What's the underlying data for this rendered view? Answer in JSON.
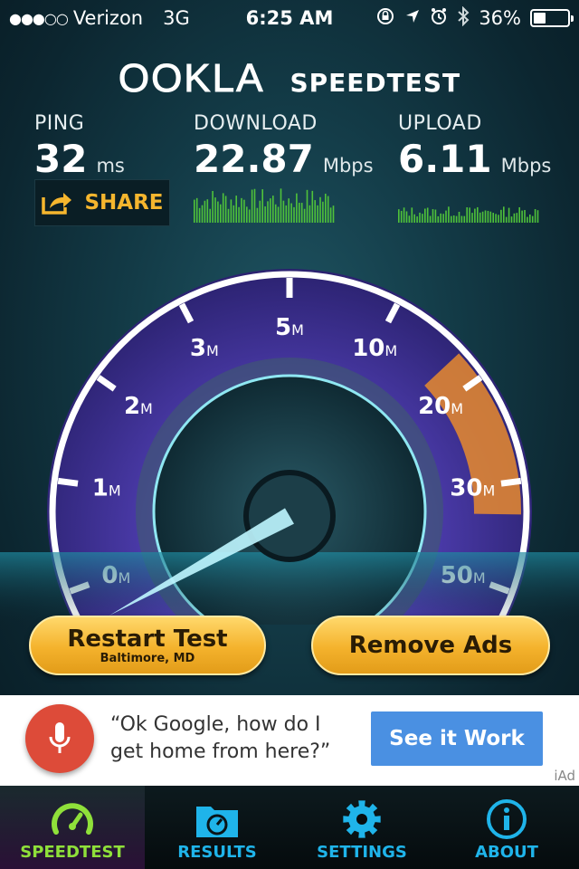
{
  "status_bar": {
    "signal": "●●●○○",
    "carrier": "Verizon",
    "network": "3G",
    "time": "6:25 AM",
    "battery_text": "36%",
    "battery_level": 0.36
  },
  "logo": {
    "brand": "OOKLA",
    "product": "SPEEDTEST"
  },
  "stats": {
    "ping": {
      "label": "PING",
      "value": "32",
      "unit": "ms"
    },
    "download": {
      "label": "DOWNLOAD",
      "value": "22.87",
      "unit": "Mbps"
    },
    "upload": {
      "label": "UPLOAD",
      "value": "6.11",
      "unit": "Mbps"
    }
  },
  "share": {
    "label": "SHARE"
  },
  "gauge": {
    "ticks": [
      {
        "label": "0",
        "unit": "M"
      },
      {
        "label": "1",
        "unit": "M"
      },
      {
        "label": "2",
        "unit": "M"
      },
      {
        "label": "3",
        "unit": "M"
      },
      {
        "label": "5",
        "unit": "M"
      },
      {
        "label": "10",
        "unit": "M"
      },
      {
        "label": "20",
        "unit": "M"
      },
      {
        "label": "30",
        "unit": "M"
      },
      {
        "label": "50",
        "unit": "M"
      }
    ],
    "colors": {
      "accent": "#7b5cff",
      "progress": "#e88a2e",
      "needle": "#9ff0ff"
    }
  },
  "actions": {
    "restart_label": "Restart Test",
    "restart_location": "Baltimore, MD",
    "remove_ads_label": "Remove Ads"
  },
  "ad": {
    "text": "“Ok Google, how do I get home from here?”",
    "cta": "See it Work",
    "label": "iAd"
  },
  "tabs": [
    {
      "label": "SPEEDTEST",
      "icon": "speedometer-icon",
      "active": true
    },
    {
      "label": "RESULTS",
      "icon": "results-folder-icon",
      "active": false
    },
    {
      "label": "SETTINGS",
      "icon": "gear-icon",
      "active": false
    },
    {
      "label": "ABOUT",
      "icon": "info-icon",
      "active": false
    }
  ]
}
